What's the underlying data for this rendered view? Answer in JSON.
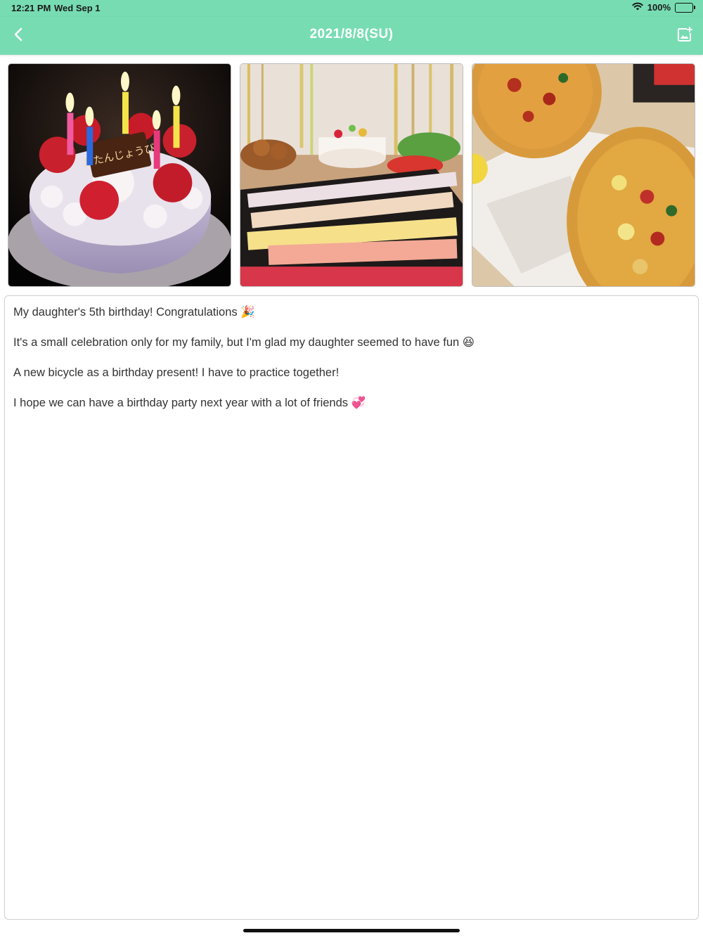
{
  "status_bar": {
    "time": "12:21 PM",
    "date": "Wed Sep 1",
    "battery_percent": "100%",
    "battery_level": 1.0
  },
  "nav": {
    "title": "2021/8/8(SU)",
    "back_icon": "chevron-left-icon",
    "add_photo_icon": "add-photo-icon",
    "background_color": "#78dcb3"
  },
  "photos": [
    {
      "subject": "birthday-cake"
    },
    {
      "subject": "party-table-sushi"
    },
    {
      "subject": "pizza"
    }
  ],
  "note": {
    "lines": [
      "My daughter's 5th birthday!  Congratulations 🎉",
      "It's a small celebration only for my family, but I'm glad my daughter seemed to have fun 😆",
      "A new bicycle as a birthday present!  I have to practice together!",
      "I hope we can have a birthday party next year with a lot of friends 💞"
    ]
  }
}
